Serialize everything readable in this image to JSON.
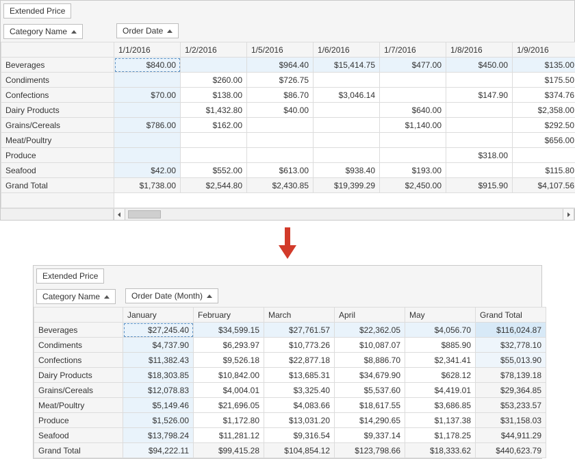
{
  "pivot1": {
    "measure_field": "Extended Price",
    "row_field": "Category Name",
    "col_field": "Order Date",
    "columns": [
      "1/1/2016",
      "1/2/2016",
      "1/5/2016",
      "1/6/2016",
      "1/7/2016",
      "1/8/2016",
      "1/9/2016"
    ],
    "rows": [
      {
        "name": "Beverages",
        "values": [
          "$840.00",
          "",
          "$964.40",
          "$15,414.75",
          "$477.00",
          "$450.00",
          "$135.00"
        ]
      },
      {
        "name": "Condiments",
        "values": [
          "",
          "$260.00",
          "$726.75",
          "",
          "",
          "",
          "$175.50"
        ]
      },
      {
        "name": "Confections",
        "values": [
          "$70.00",
          "$138.00",
          "$86.70",
          "$3,046.14",
          "",
          "$147.90",
          "$374.76"
        ]
      },
      {
        "name": "Dairy Products",
        "values": [
          "",
          "$1,432.80",
          "$40.00",
          "",
          "$640.00",
          "",
          "$2,358.00"
        ]
      },
      {
        "name": "Grains/Cereals",
        "values": [
          "$786.00",
          "$162.00",
          "",
          "",
          "$1,140.00",
          "",
          "$292.50"
        ]
      },
      {
        "name": "Meat/Poultry",
        "values": [
          "",
          "",
          "",
          "",
          "",
          "",
          "$656.00"
        ]
      },
      {
        "name": "Produce",
        "values": [
          "",
          "",
          "",
          "",
          "",
          "$318.00",
          ""
        ]
      },
      {
        "name": "Seafood",
        "values": [
          "$42.00",
          "$552.00",
          "$613.00",
          "$938.40",
          "$193.00",
          "",
          "$115.80"
        ]
      }
    ],
    "grand_total_label": "Grand Total",
    "grand_total_values": [
      "$1,738.00",
      "$2,544.80",
      "$2,430.85",
      "$19,399.29",
      "$2,450.00",
      "$915.90",
      "$4,107.56"
    ]
  },
  "pivot2": {
    "measure_field": "Extended Price",
    "row_field": "Category Name",
    "col_field": "Order Date (Month)",
    "columns": [
      "January",
      "February",
      "March",
      "April",
      "May",
      "Grand Total"
    ],
    "rows": [
      {
        "name": "Beverages",
        "values": [
          "$27,245.40",
          "$34,599.15",
          "$27,761.57",
          "$22,362.05",
          "$4,056.70",
          "$116,024.87"
        ]
      },
      {
        "name": "Condiments",
        "values": [
          "$4,737.90",
          "$6,293.97",
          "$10,773.26",
          "$10,087.07",
          "$885.90",
          "$32,778.10"
        ]
      },
      {
        "name": "Confections",
        "values": [
          "$11,382.43",
          "$9,526.18",
          "$22,877.18",
          "$8,886.70",
          "$2,341.41",
          "$55,013.90"
        ]
      },
      {
        "name": "Dairy Products",
        "values": [
          "$18,303.85",
          "$10,842.00",
          "$13,685.31",
          "$34,679.90",
          "$628.12",
          "$78,139.18"
        ]
      },
      {
        "name": "Grains/Cereals",
        "values": [
          "$12,078.83",
          "$4,004.01",
          "$3,325.40",
          "$5,537.60",
          "$4,419.01",
          "$29,364.85"
        ]
      },
      {
        "name": "Meat/Poultry",
        "values": [
          "$5,149.46",
          "$21,696.05",
          "$4,083.66",
          "$18,617.55",
          "$3,686.85",
          "$53,233.57"
        ]
      },
      {
        "name": "Produce",
        "values": [
          "$1,526.00",
          "$1,172.80",
          "$13,031.20",
          "$14,290.65",
          "$1,137.38",
          "$31,158.03"
        ]
      },
      {
        "name": "Seafood",
        "values": [
          "$13,798.24",
          "$11,281.12",
          "$9,316.54",
          "$9,337.14",
          "$1,178.25",
          "$44,911.29"
        ]
      }
    ],
    "grand_total_label": "Grand Total",
    "grand_total_values": [
      "$94,222.11",
      "$99,415.28",
      "$104,854.12",
      "$123,798.66",
      "$18,333.62",
      "$440,623.79"
    ]
  },
  "colors": {
    "highlight": "#e9f3fb",
    "highlight_strong": "#d7e9f7",
    "arrow": "#d23a2a"
  }
}
